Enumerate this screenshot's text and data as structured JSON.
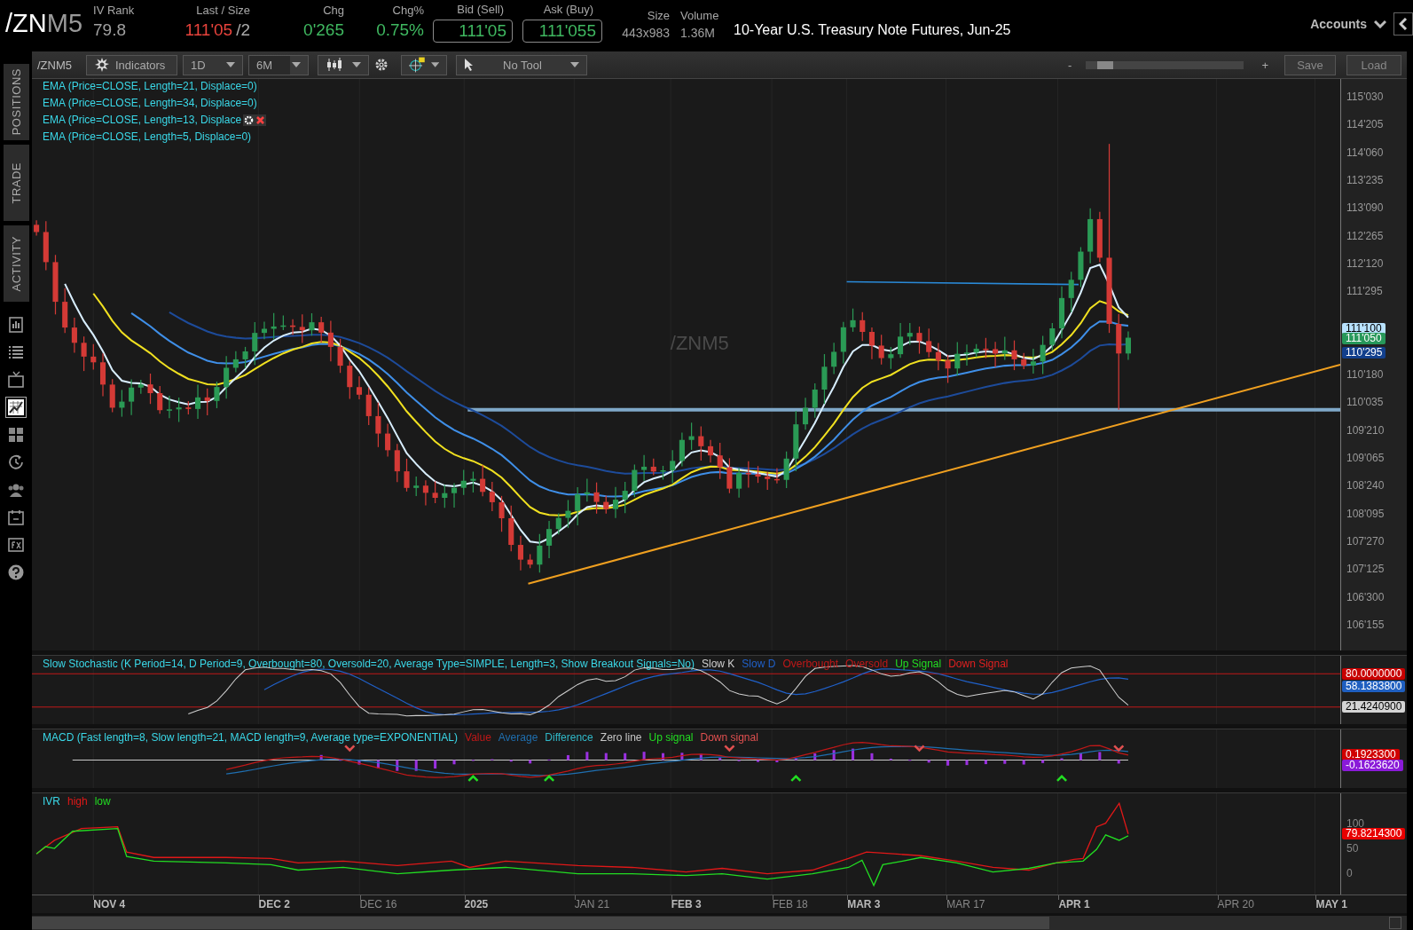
{
  "header": {
    "symbol": "/ZN",
    "symbol_suffix": "M5",
    "fields": [
      {
        "label": "IV Rank",
        "value": "79.8",
        "color": "#a0a0a0"
      },
      {
        "label": "Last / Size",
        "value": "111'05",
        "extra": "/2",
        "color": "#e8433c"
      },
      {
        "label": "Chg",
        "value": "0'265",
        "color": "#3fb860"
      },
      {
        "label": "Chg%",
        "value": "0.75%",
        "color": "#3fb860"
      },
      {
        "label": "Bid (Sell)",
        "value": "111'05",
        "color": "#3fb860",
        "boxed": true
      },
      {
        "label": "Ask (Buy)",
        "value": "111'055",
        "color": "#3fb860",
        "boxed": true
      },
      {
        "label": "Size",
        "value": "443x983",
        "color": "#a0a0a0"
      },
      {
        "label": "Volume",
        "value": "1.36M",
        "color": "#a0a0a0"
      }
    ],
    "description": "10-Year U.S. Treasury Note Futures, Jun-25",
    "accounts": "Accounts"
  },
  "sidebar": {
    "tabs": [
      {
        "label": "POSITIONS"
      },
      {
        "label": "TRADE"
      },
      {
        "label": "ACTIVITY"
      }
    ],
    "tools": [
      {
        "kind": "news",
        "selected": false
      },
      {
        "kind": "list",
        "selected": false
      },
      {
        "kind": "tv",
        "selected": false
      },
      {
        "kind": "chart",
        "selected": true
      },
      {
        "kind": "grid",
        "selected": false
      },
      {
        "kind": "clock",
        "selected": false
      },
      {
        "kind": "people",
        "selected": false
      },
      {
        "kind": "calendar",
        "selected": false
      },
      {
        "kind": "fx",
        "selected": false
      },
      {
        "kind": "help",
        "selected": false
      }
    ]
  },
  "toolbar": {
    "symbol": "/ZNM5",
    "indicators": "Indicators",
    "aggregation": "1D",
    "period": "6M",
    "drawing_tool": "No Tool",
    "zoom_minus": "-",
    "zoom_plus": "+",
    "zoom": {
      "level": 0.08
    },
    "save": "Save",
    "load": "Load"
  },
  "price_pane": {
    "studies": [
      {
        "label": "EMA (Price=CLOSE, Length=21, Displace=0)",
        "hover_controls": false
      },
      {
        "label": "EMA (Price=CLOSE, Length=34, Displace=0)",
        "hover_controls": false
      },
      {
        "label": "EMA (Price=CLOSE, Length=13, Displace",
        "hover_controls": true
      },
      {
        "label": "EMA (Price=CLOSE, Length=5, Displace=0)",
        "hover_controls": false
      }
    ],
    "watermark": "/ZNM5",
    "axis_ticks": [
      "115'030",
      "114'205",
      "114'060",
      "113'235",
      "113'090",
      "112'265",
      "112'120",
      "111'295",
      "110'180",
      "110'035",
      "109'210",
      "109'065",
      "108'240",
      "108'095",
      "107'270",
      "107'125",
      "106'300",
      "106'155"
    ],
    "price_tags": [
      {
        "text": "111'100",
        "color": "#b8e2ff"
      },
      {
        "text": "111'050",
        "color": "#27985a"
      },
      {
        "text": "110'295",
        "color": "#123f8c"
      }
    ]
  },
  "studies": [
    {
      "kind": "stochastic",
      "title": "Slow Stochastic (K Period=14, D Period=9, Overbought=80, Oversold=20, Average Type=SIMPLE, Length=3, Show Breakout Signals=No)",
      "legend": [
        {
          "label": "Slow K",
          "color": "#d0d0d0"
        },
        {
          "label": "Slow D",
          "color": "#2060c8"
        },
        {
          "label": "Overbought",
          "color": "#c01818"
        },
        {
          "label": "Oversold",
          "color": "#c01818"
        },
        {
          "label": "Up Signal",
          "color": "#22dd22"
        },
        {
          "label": "Down Signal",
          "color": "#e02020"
        }
      ],
      "axis_tags": [
        {
          "text": "80.0000000",
          "color": "#c80000"
        },
        {
          "text": "58.1383800",
          "color": "#1f5fc0"
        },
        {
          "text": "21.4240900",
          "color": "#d4d4d4"
        }
      ]
    },
    {
      "kind": "macd",
      "title": "MACD (Fast length=8, Slow length=21, MACD length=9, Average type=EXPONENTIAL)",
      "legend": [
        {
          "label": "Value",
          "color": "#c01818"
        },
        {
          "label": "Average",
          "color": "#1f6fb0"
        },
        {
          "label": "Difference",
          "color": "#30b8c8"
        },
        {
          "label": "Zero line",
          "color": "#c8c8c8"
        },
        {
          "label": "Up signal",
          "color": "#22dd22"
        },
        {
          "label": "Down signal",
          "color": "#e05050"
        }
      ],
      "axis_tags": [
        {
          "text": "0.1923300",
          "color": "#d00000"
        },
        {
          "text": "-0.1623620",
          "color": "#8a1ad8"
        }
      ]
    },
    {
      "kind": "ivr",
      "title": "IVR",
      "legend": [
        {
          "label": "high",
          "color": "#e01818"
        },
        {
          "label": "low",
          "color": "#22dd22"
        }
      ],
      "axis_ticks": [
        "100",
        "50",
        "0"
      ],
      "axis_tags": [
        {
          "text": "79.8214300",
          "color": "#e80000"
        }
      ]
    }
  ],
  "date_axis": [
    {
      "label": "NOV 4",
      "major": true
    },
    {
      "label": "DEC 2",
      "major": true
    },
    {
      "label": "DEC 16",
      "major": false
    },
    {
      "label": "2025",
      "major": true
    },
    {
      "label": "JAN 21",
      "major": false
    },
    {
      "label": "FEB 3",
      "major": true
    },
    {
      "label": "FEB 18",
      "major": false
    },
    {
      "label": "MAR 3",
      "major": true
    },
    {
      "label": "MAR 17",
      "major": false
    },
    {
      "label": "APR 1",
      "major": true
    },
    {
      "label": "APR 20",
      "major": false
    },
    {
      "label": "MAY 1",
      "major": true
    }
  ]
}
